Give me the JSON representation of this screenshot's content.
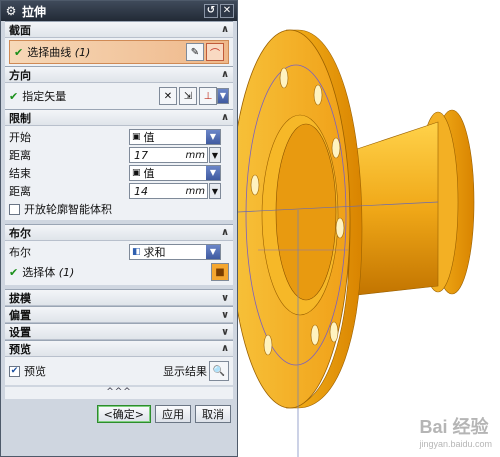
{
  "dialog": {
    "title": "拉伸",
    "title_buttons": {
      "reset": "↺",
      "close": "✕"
    },
    "sections": {
      "section": {
        "header": "截面",
        "select_curve_label": "选择曲线",
        "select_curve_count": "(1)"
      },
      "direction": {
        "header": "方向",
        "vector_label": "指定矢量"
      },
      "limits": {
        "header": "限制",
        "start_label": "开始",
        "start_value": "值",
        "start_distance_label": "距离",
        "start_distance_value": "17",
        "start_unit": "mm",
        "end_label": "结束",
        "end_value": "值",
        "end_distance_label": "距离",
        "end_distance_value": "14",
        "end_unit": "mm",
        "open_profile_label": "开放轮廓智能体积"
      },
      "boolean": {
        "header": "布尔",
        "boolean_label": "布尔",
        "boolean_value": "求和",
        "select_body_label": "选择体",
        "select_body_count": "(1)"
      },
      "draft": {
        "header": "拔模"
      },
      "offset": {
        "header": "偏置"
      },
      "settings": {
        "header": "设置"
      },
      "preview": {
        "header": "预览",
        "preview_label": "预览",
        "preview_checked": true,
        "show_result_label": "显示结果"
      }
    },
    "expand_indicator": "^^^",
    "footer": {
      "ok_label": "<确定>",
      "apply_label": "应用",
      "cancel_label": "取消"
    }
  },
  "viewport": {
    "model_color": "#f0a81a",
    "watermark_brand": "Bai 经验",
    "watermark_url": "jingyan.baidu.com"
  }
}
